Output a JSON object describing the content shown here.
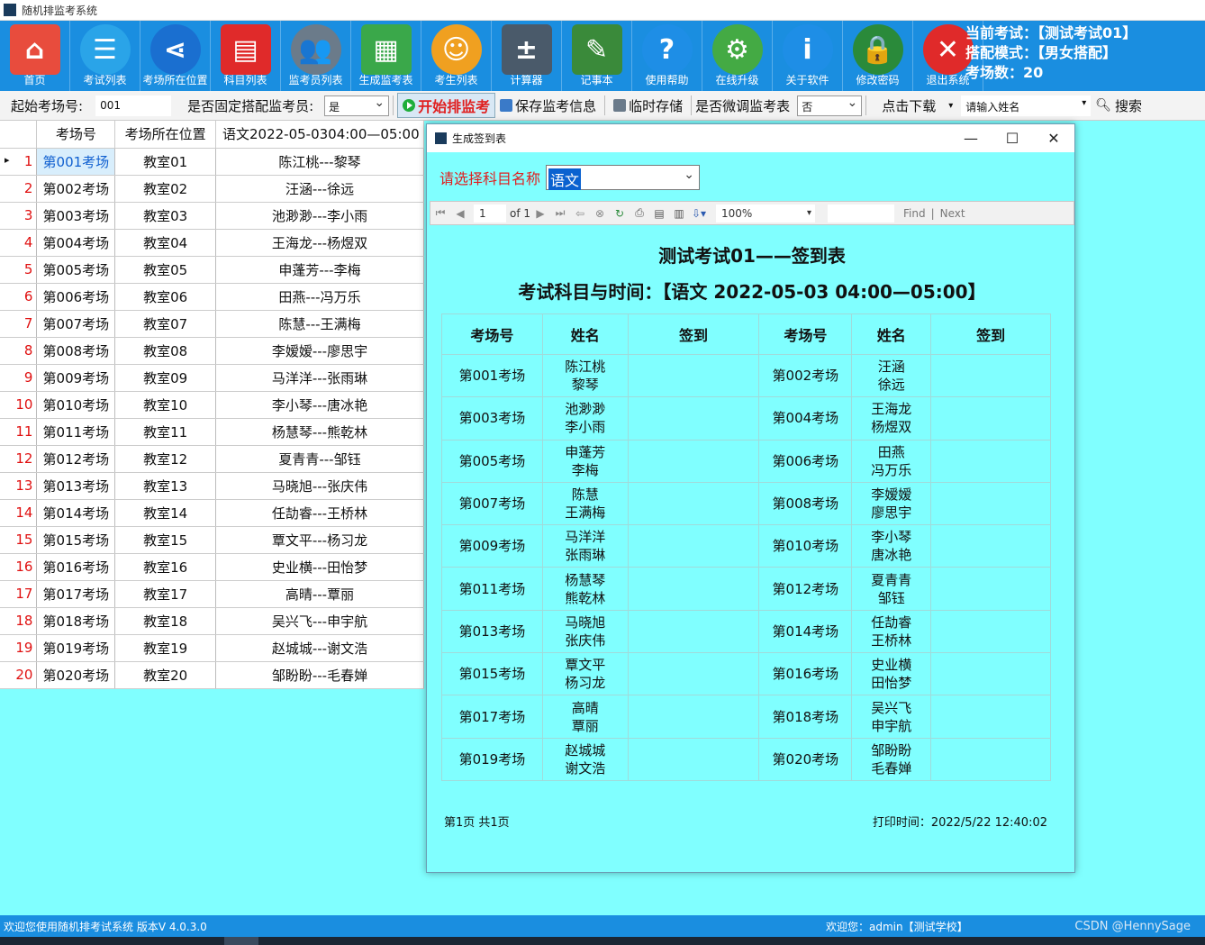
{
  "app": {
    "title": "随机排监考系统",
    "exam_info": {
      "current_exam": "当前考试：【测试考试01】",
      "mode": "搭配模式：【男女搭配】",
      "room_count": "考场数：20"
    }
  },
  "ribbon": [
    {
      "label": "首页",
      "icon": "home-icon",
      "color": "#e84c3d"
    },
    {
      "label": "考试列表",
      "icon": "list-icon",
      "color": "#2aa4e8"
    },
    {
      "label": "考场所在位置",
      "icon": "share-icon",
      "color": "#1a6fd0"
    },
    {
      "label": "科目列表",
      "icon": "book-icon",
      "color": "#e02a2a"
    },
    {
      "label": "监考员列表",
      "icon": "users-icon",
      "color": "#6b7b8a"
    },
    {
      "label": "生成监考表",
      "icon": "table-icon",
      "color": "#3aa84a"
    },
    {
      "label": "考生列表",
      "icon": "student-icon",
      "color": "#f0a020"
    },
    {
      "label": "计算器",
      "icon": "calculator-icon",
      "color": "#4a5a6a"
    },
    {
      "label": "记事本",
      "icon": "notepad-icon",
      "color": "#3a8a3a"
    },
    {
      "label": "使用帮助",
      "icon": "help-icon",
      "color": "#1e8ee6"
    },
    {
      "label": "在线升级",
      "icon": "gear-icon",
      "color": "#44aa44"
    },
    {
      "label": "关于软件",
      "icon": "info-icon",
      "color": "#1e8ee6"
    },
    {
      "label": "修改密码",
      "icon": "lock-icon",
      "color": "#2a8a3a"
    },
    {
      "label": "退出系统",
      "icon": "close-icon",
      "color": "#e02a2a"
    }
  ],
  "toolbar": {
    "start_room_label": "起始考场号:",
    "start_room_value": "001",
    "fixed_pair_label": "是否固定搭配监考员:",
    "fixed_pair_value": "是",
    "start_btn": "开始排监考",
    "save_btn": "保存监考信息",
    "temp_save_btn": "临时存储",
    "tweak_label": "是否微调监考表",
    "tweak_value": "否",
    "download_btn": "点击下载",
    "name_placeholder": "请输入姓名",
    "search_btn": "搜索"
  },
  "grid": {
    "headers": [
      "考场号",
      "考场所在位置",
      "语文2022-05-0304:00—05:00"
    ],
    "rows": [
      {
        "n": "1",
        "room": "第001考场",
        "loc": "教室01",
        "pair": "陈江桃---黎琴"
      },
      {
        "n": "2",
        "room": "第002考场",
        "loc": "教室02",
        "pair": "汪涵---徐远"
      },
      {
        "n": "3",
        "room": "第003考场",
        "loc": "教室03",
        "pair": "池渺渺---李小雨"
      },
      {
        "n": "4",
        "room": "第004考场",
        "loc": "教室04",
        "pair": "王海龙---杨煜双"
      },
      {
        "n": "5",
        "room": "第005考场",
        "loc": "教室05",
        "pair": "申蓬芳---李梅"
      },
      {
        "n": "6",
        "room": "第006考场",
        "loc": "教室06",
        "pair": "田燕---冯万乐"
      },
      {
        "n": "7",
        "room": "第007考场",
        "loc": "教室07",
        "pair": "陈慧---王满梅"
      },
      {
        "n": "8",
        "room": "第008考场",
        "loc": "教室08",
        "pair": "李嫒嫒---廖思宇"
      },
      {
        "n": "9",
        "room": "第009考场",
        "loc": "教室09",
        "pair": "马洋洋---张雨琳"
      },
      {
        "n": "10",
        "room": "第010考场",
        "loc": "教室10",
        "pair": "李小琴---唐冰艳"
      },
      {
        "n": "11",
        "room": "第011考场",
        "loc": "教室11",
        "pair": "杨慧琴---熊乾林"
      },
      {
        "n": "12",
        "room": "第012考场",
        "loc": "教室12",
        "pair": "夏青青---邹钰"
      },
      {
        "n": "13",
        "room": "第013考场",
        "loc": "教室13",
        "pair": "马晓旭---张庆伟"
      },
      {
        "n": "14",
        "room": "第014考场",
        "loc": "教室14",
        "pair": "任劼睿---王桥林"
      },
      {
        "n": "15",
        "room": "第015考场",
        "loc": "教室15",
        "pair": "覃文平---杨习龙"
      },
      {
        "n": "16",
        "room": "第016考场",
        "loc": "教室16",
        "pair": "史业横---田怡梦"
      },
      {
        "n": "17",
        "room": "第017考场",
        "loc": "教室17",
        "pair": "高晴---覃丽"
      },
      {
        "n": "18",
        "room": "第018考场",
        "loc": "教室18",
        "pair": "吴兴飞---申宇航"
      },
      {
        "n": "19",
        "room": "第019考场",
        "loc": "教室19",
        "pair": "赵城城---谢文浩"
      },
      {
        "n": "20",
        "room": "第020考场",
        "loc": "教室20",
        "pair": "邹盼盼---毛春婵"
      }
    ]
  },
  "dialog": {
    "title": "生成签到表",
    "subject_label": "请选择科目名称",
    "subject_value": "语文",
    "viewer": {
      "page": "1",
      "of": "of 1",
      "zoom": "100%",
      "find": "Find",
      "next": "Next"
    },
    "report": {
      "title": "测试考试01——签到表",
      "subtitle": "考试科目与时间：【语文 2022-05-03 04:00—05:00】",
      "headers": [
        "考场号",
        "姓名",
        "签到",
        "考场号",
        "姓名",
        "签到"
      ],
      "rows": [
        {
          "r1": "第001考场",
          "a1": "陈江桃",
          "b1": "黎琴",
          "r2": "第002考场",
          "a2": "汪涵",
          "b2": "徐远"
        },
        {
          "r1": "第003考场",
          "a1": "池渺渺",
          "b1": "李小雨",
          "r2": "第004考场",
          "a2": "王海龙",
          "b2": "杨煜双"
        },
        {
          "r1": "第005考场",
          "a1": "申蓬芳",
          "b1": "李梅",
          "r2": "第006考场",
          "a2": "田燕",
          "b2": "冯万乐"
        },
        {
          "r1": "第007考场",
          "a1": "陈慧",
          "b1": "王满梅",
          "r2": "第008考场",
          "a2": "李嫒嫒",
          "b2": "廖思宇"
        },
        {
          "r1": "第009考场",
          "a1": "马洋洋",
          "b1": "张雨琳",
          "r2": "第010考场",
          "a2": "李小琴",
          "b2": "唐冰艳"
        },
        {
          "r1": "第011考场",
          "a1": "杨慧琴",
          "b1": "熊乾林",
          "r2": "第012考场",
          "a2": "夏青青",
          "b2": "邹钰"
        },
        {
          "r1": "第013考场",
          "a1": "马晓旭",
          "b1": "张庆伟",
          "r2": "第014考场",
          "a2": "任劼睿",
          "b2": "王桥林"
        },
        {
          "r1": "第015考场",
          "a1": "覃文平",
          "b1": "杨习龙",
          "r2": "第016考场",
          "a2": "史业横",
          "b2": "田怡梦"
        },
        {
          "r1": "第017考场",
          "a1": "高晴",
          "b1": "覃丽",
          "r2": "第018考场",
          "a2": "吴兴飞",
          "b2": "申宇航"
        },
        {
          "r1": "第019考场",
          "a1": "赵城城",
          "b1": "谢文浩",
          "r2": "第020考场",
          "a2": "邹盼盼",
          "b2": "毛春婵"
        }
      ],
      "footer_left": "第1页  共1页",
      "footer_right": "打印时间：2022/5/22 12:40:02"
    }
  },
  "status": {
    "left": "欢迎您使用随机排考试系统  版本V 4.0.3.0",
    "right": "欢迎您：admin【测试学校】",
    "watermark": "CSDN @HennySage"
  }
}
